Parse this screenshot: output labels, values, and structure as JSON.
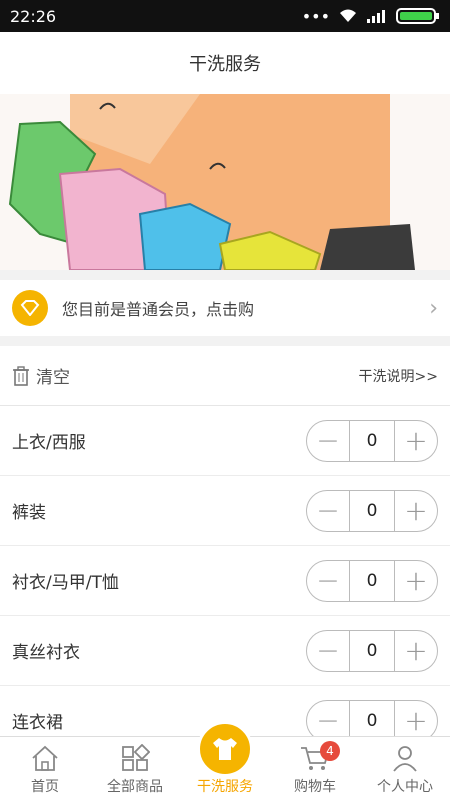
{
  "statusbar": {
    "time": "22:26"
  },
  "header": {
    "title": "干洗服务"
  },
  "member": {
    "text": "您目前是普通会员，点击购"
  },
  "toolbar": {
    "clear_label": "清空",
    "info_link": "干洗说明>>"
  },
  "items": [
    {
      "name": "上衣/西服",
      "qty": "0"
    },
    {
      "name": "裤装",
      "qty": "0"
    },
    {
      "name": "衬衣/马甲/T恤",
      "qty": "0"
    },
    {
      "name": "真丝衬衣",
      "qty": "0"
    },
    {
      "name": "连衣裙",
      "qty": "0"
    }
  ],
  "tabs": [
    {
      "label": "首页",
      "icon": "home-icon"
    },
    {
      "label": "全部商品",
      "icon": "grid-icon"
    },
    {
      "label": "干洗服务",
      "icon": "shirt-icon",
      "active": true
    },
    {
      "label": "购物车",
      "icon": "cart-icon",
      "badge": "4"
    },
    {
      "label": "个人中心",
      "icon": "user-icon"
    }
  ],
  "colors": {
    "accent": "#f5b400",
    "badge": "#e64a3c"
  }
}
